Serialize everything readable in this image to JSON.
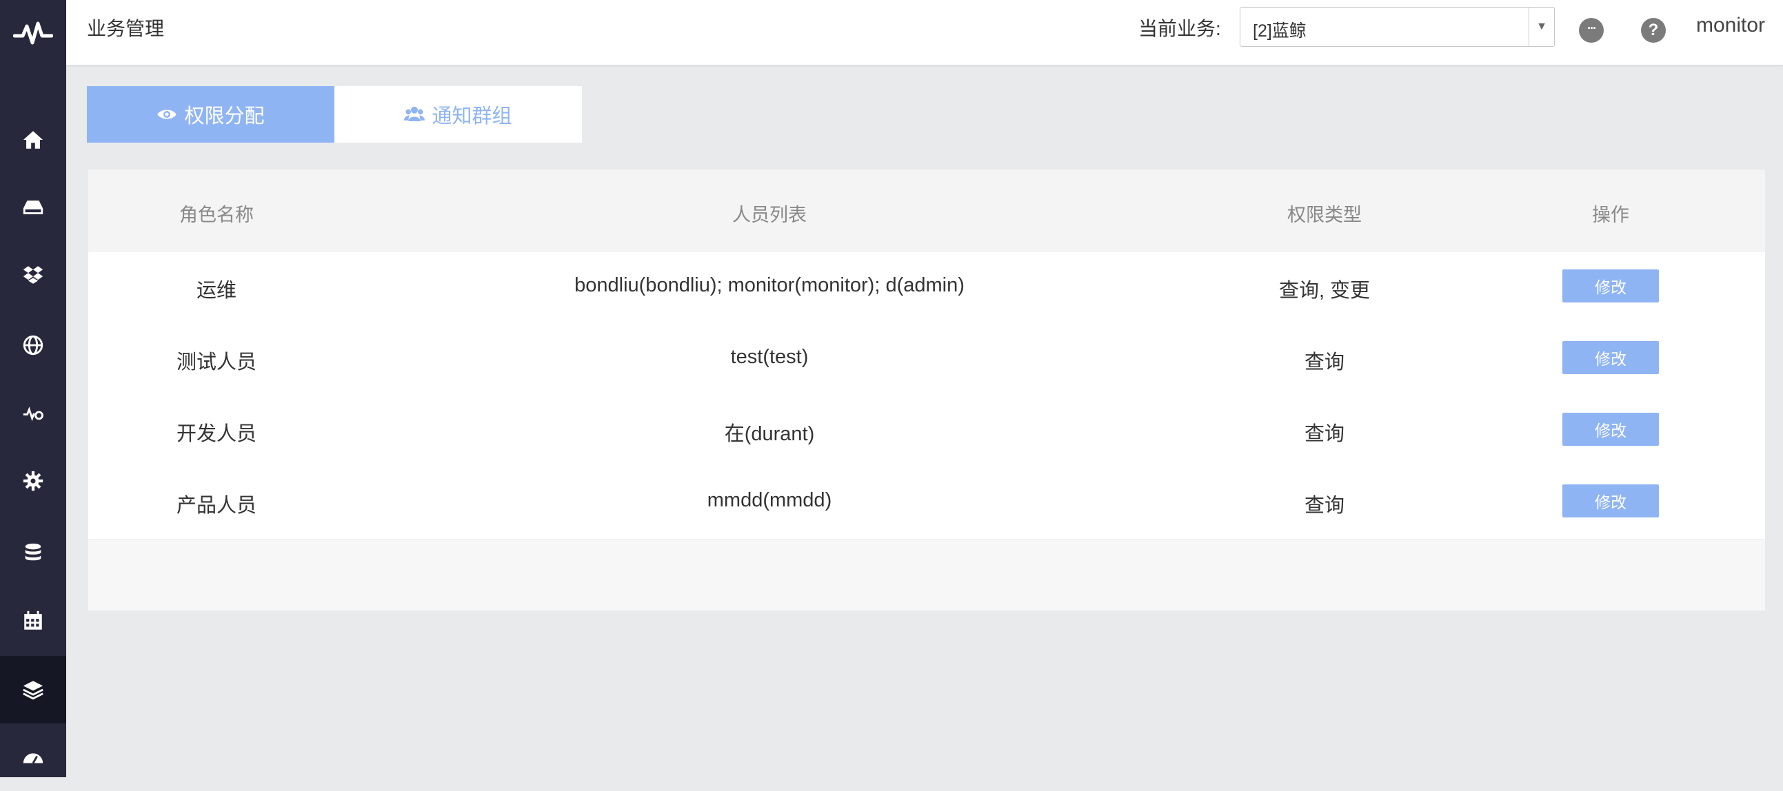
{
  "header": {
    "title": "业务管理",
    "business_label": "当前业务:",
    "business_value": "[2]蓝鲸",
    "username": "monitor",
    "more_glyph": "···",
    "help_glyph": "?"
  },
  "sidebar": {
    "items": [
      {
        "icon": "home-icon"
      },
      {
        "icon": "hdd-icon"
      },
      {
        "icon": "dropbox-icon"
      },
      {
        "icon": "globe-icon"
      },
      {
        "icon": "heartbeat-gear-icon"
      },
      {
        "icon": "gear-icon"
      },
      {
        "icon": "database-icon"
      },
      {
        "icon": "calendar-icon"
      },
      {
        "icon": "layers-icon",
        "active": true
      },
      {
        "icon": "dashboard-icon"
      }
    ]
  },
  "tabs": [
    {
      "label": "权限分配",
      "icon": "eye-icon",
      "active": true
    },
    {
      "label": "通知群组",
      "icon": "users-icon",
      "active": false
    }
  ],
  "table": {
    "headers": [
      "角色名称",
      "人员列表",
      "权限类型",
      "操作"
    ],
    "rows": [
      {
        "role": "运维",
        "members": "bondliu(bondliu); monitor(monitor); d(admin)",
        "perm": "查询, 变更",
        "action": "修改"
      },
      {
        "role": "测试人员",
        "members": "test(test)",
        "perm": "查询",
        "action": "修改"
      },
      {
        "role": "开发人员",
        "members": "在(durant)",
        "perm": "查询",
        "action": "修改"
      },
      {
        "role": "产品人员",
        "members": "mmdd(mmdd)",
        "perm": "查询",
        "action": "修改"
      }
    ]
  },
  "colors": {
    "sidebar_bg": "#27283b",
    "sidebar_active": "#161724",
    "accent": "#8fb4f4",
    "page_bg": "#e9eaec"
  }
}
